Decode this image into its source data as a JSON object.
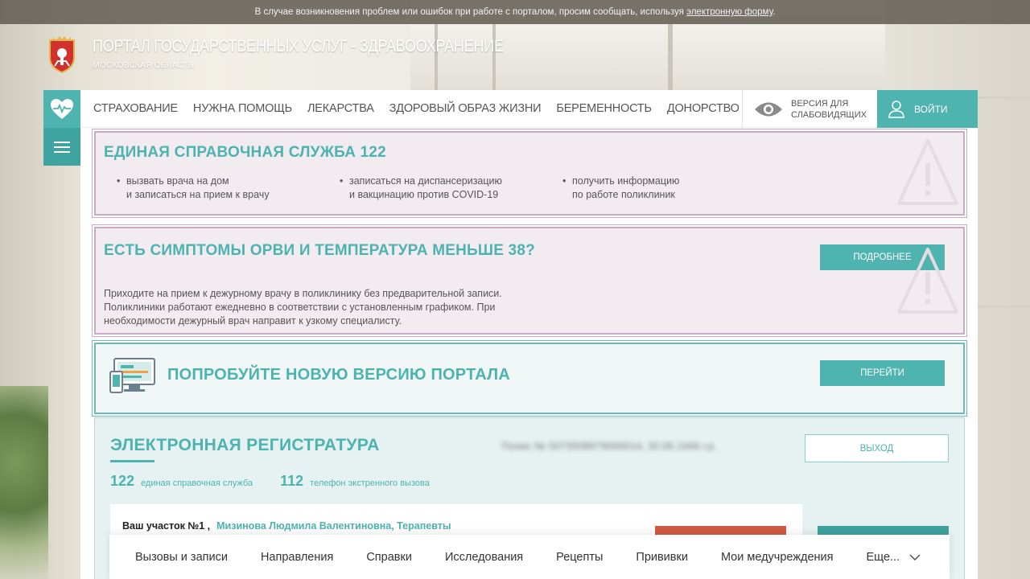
{
  "notice": {
    "text": "В случае возникновения проблем или ошибок при работе с порталом, просим сообщать, используя ",
    "link": "электронную форму",
    "end": "."
  },
  "header": {
    "title": "ПОРТАЛ ГОСУДАРСТВЕННЫХ УСЛУГ - ЗДРАВООХРАНЕНИЕ",
    "subtitle": "МОСКОВСКАЯ ОБЛАСТЬ"
  },
  "nav": {
    "items": [
      "Страхование",
      "Нужна помощь",
      "Лекарства",
      "Здоровый образ жизни",
      "Беременность",
      "Донорство"
    ],
    "vision_line1": "Версия для",
    "vision_line2": "слабовидящих",
    "login": "Войти"
  },
  "help_service": {
    "title": "ЕДИНАЯ СПРАВОЧНАЯ СЛУЖБА 122",
    "bullets": [
      {
        "line1": "вызвать врача на дом",
        "line2": "и записаться на прием к врачу"
      },
      {
        "line1": "записаться на диспансеризацию",
        "line2": "и вакцинацию против COVID-19"
      },
      {
        "line1": "получить информацию",
        "line2": "по работе поликлиник"
      }
    ]
  },
  "symptoms": {
    "title": "ЕСТЬ СИМПТОМЫ ОРВИ И ТЕМПЕРАТУРА МЕНЬШЕ 38?",
    "text": "Приходите на прием к дежурному врачу в поликлинику без предварительной записи. Поликлиники работают ежедневно в соответствии с установленным графиком. При необходимости дежурный врач направит к узкому специалисту.",
    "button": "Подробнее"
  },
  "new_version": {
    "title": "ПОПРОБУЙТЕ НОВУЮ ВЕРСИЮ ПОРТАЛА",
    "button": "Перейти"
  },
  "registry": {
    "title": "ЭЛЕКТРОННАЯ РЕГИСТРАТУРА",
    "policy": "Полис № 5073508979000014, 30.06.1946 г.р.",
    "exit": "Выход",
    "phones": [
      {
        "number": "122",
        "label": "единая справочная служба"
      },
      {
        "number": "112",
        "label": "телефон экстренного вызова"
      }
    ],
    "district": "Ваш участок №1 ,",
    "doctor": "Мизинова Людмила Валентиновна, Терапевты"
  },
  "tabs": {
    "items": [
      "Вызовы и записи",
      "Направления",
      "Справки",
      "Исследования",
      "Рецепты",
      "Прививки",
      "Мои медучреждения"
    ],
    "more": "Еще..."
  },
  "colors": {
    "accent": "#4fb3b0",
    "pink_bg": "#f2ecf1",
    "pink_border": "#c8a9c6",
    "alert_red": "#d35b43"
  },
  "icons": [
    "heart-pulse-icon",
    "hamburger-icon",
    "eye-icon",
    "user-icon",
    "warning-icon",
    "devices-icon",
    "chevron-down-icon",
    "coat-of-arms-icon"
  ]
}
